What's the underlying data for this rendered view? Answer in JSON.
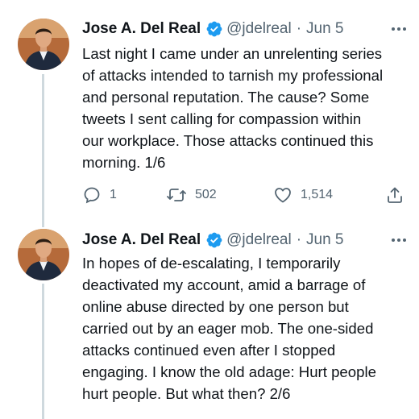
{
  "tweets": [
    {
      "author_name": "Jose A. Del Real",
      "handle": "@jdelreal",
      "separator": "·",
      "date": "Jun 5",
      "text": "Last night I came under an unrelenting series\nof attacks intended to tarnish my professional\nand personal reputation. The cause? Some\ntweets I sent calling for compassion within\nour workplace. Those attacks continued this\nmorning. 1/6",
      "replies": "1",
      "retweets": "502",
      "likes": "1,514"
    },
    {
      "author_name": "Jose A. Del Real",
      "handle": "@jdelreal",
      "separator": "·",
      "date": "Jun 5",
      "text": "In hopes of de-escalating, I temporarily\ndeactivated my account, amid a barrage of\nonline abuse directed by one person but\ncarried out by an eager mob. The one-sided\nattacks continued even after I stopped\nengaging. I know the old adage: Hurt people\nhurt people. But what then? 2/6"
    }
  ],
  "colors": {
    "verified_badge": "#1d9bf0",
    "secondary_text": "#536471",
    "thread_line": "#cfd9de"
  },
  "icons": [
    "reply-icon",
    "retweet-icon",
    "like-icon",
    "share-icon",
    "verified-badge-icon",
    "more-options-icon"
  ]
}
